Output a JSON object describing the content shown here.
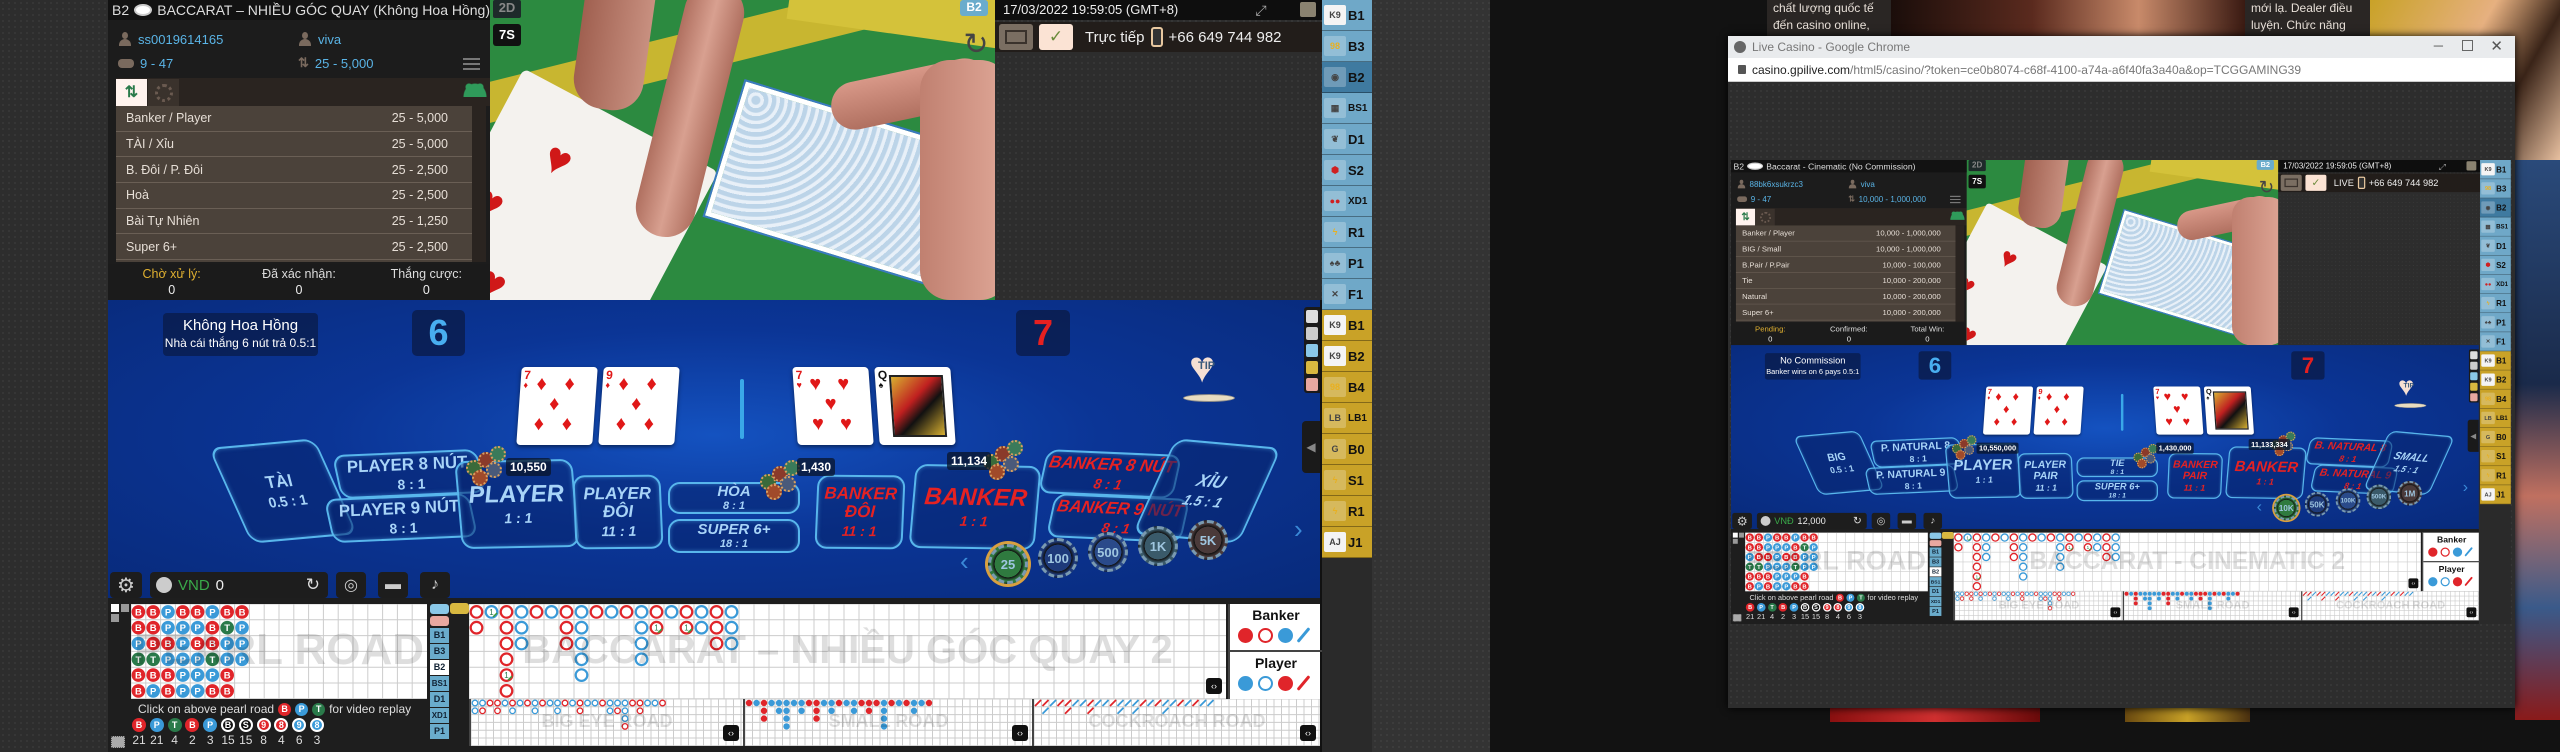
{
  "colors": {
    "table_blue": "#0b3596",
    "player_blue": "#3a9ad8",
    "banker_red": "#e0252a",
    "tie_green": "#2a7a4a",
    "sidebar_blue": "#6fa8c8",
    "sidebar_gold": "#c9a227",
    "accent_text": "#5ab4e6"
  },
  "main_game": {
    "title": {
      "table_code": "B2",
      "name": "BACCARAT – NHIỀU GÓC QUAY (Không Hoa Hồng)"
    },
    "user": {
      "account": "ss0019614165",
      "dealer": "viva",
      "round": "9 - 47",
      "limit": "25 - 5,000"
    },
    "limits": [
      {
        "label": "Banker / Player",
        "range": "25 - 5,000"
      },
      {
        "label": "TÀI / Xỉu",
        "range": "25 - 5,000"
      },
      {
        "label": "B. Đôi / P. Đôi",
        "range": "25 - 2,500"
      },
      {
        "label": "Hoà",
        "range": "25 - 2,500"
      },
      {
        "label": "Bài Tự Nhiên",
        "range": "25 - 1,250"
      },
      {
        "label": "Super 6+",
        "range": "25 - 2,500"
      }
    ],
    "status": [
      {
        "label": "Chờ xử lý:",
        "value": "0"
      },
      {
        "label": "Đã xác nhận:",
        "value": "0"
      },
      {
        "label": "Thắng cược:",
        "value": "0"
      }
    ],
    "video": {
      "mode": "2D",
      "shoe": "7S",
      "table": "B2"
    },
    "header": {
      "datetime": "17/03/2022 19:59:05 (GMT+8)",
      "live_label": "Trực tiếp",
      "phone": "+66 649 744 982"
    },
    "table": {
      "rule_title": "Không Hoa Hồng",
      "rule_desc": "Nhà cái thắng 6 nút trả 0.5:1",
      "player_score": "6",
      "banker_score": "7",
      "player_cards": [
        {
          "rank": "7",
          "suit": "♦"
        },
        {
          "rank": "9",
          "suit": "♦"
        }
      ],
      "banker_cards": [
        {
          "rank": "7",
          "suit": "♥"
        },
        {
          "rank": "Q",
          "suit": "♠"
        }
      ],
      "tip": "TIP",
      "bets": [
        {
          "key": "big",
          "label": "TÀI",
          "odds": "0.5 : 1"
        },
        {
          "key": "p8",
          "label": "PLAYER 8 NÚT",
          "odds": "8 : 1"
        },
        {
          "key": "p9",
          "label": "PLAYER 9 NÚT",
          "odds": "8 : 1"
        },
        {
          "key": "player",
          "label": "PLAYER",
          "odds": "1 : 1"
        },
        {
          "key": "ppair",
          "label": "PLAYER ĐÔI",
          "odds": "11 : 1"
        },
        {
          "key": "tie",
          "label": "HÒA",
          "odds": "8 : 1"
        },
        {
          "key": "super6",
          "label": "SUPER 6+",
          "odds": "18 : 1"
        },
        {
          "key": "bpair",
          "label": "BANKER ĐÔI",
          "odds": "11 : 1"
        },
        {
          "key": "banker",
          "label": "BANKER",
          "odds": "1 : 1"
        },
        {
          "key": "b8",
          "label": "BANKER 8 NÚT",
          "odds": "8 : 1"
        },
        {
          "key": "b9",
          "label": "BANKER 9 NÚT",
          "odds": "8 : 1"
        },
        {
          "key": "small",
          "label": "XỈU",
          "odds": "1.5 : 1"
        }
      ],
      "chip_totals": {
        "player": "10,550",
        "tie": "1,430",
        "banker": "11,134"
      },
      "chips": [
        "25",
        "100",
        "500",
        "1K",
        "5K"
      ],
      "selected_chip": "25",
      "currency": "VND",
      "balance": "0"
    },
    "roads": {
      "pearl_title": "PEARL ROAD",
      "big_road_title": "BACCARAT – NHIỀU GÓC QUAY 2",
      "big_eye_title": "BIG EYE ROAD",
      "small_title": "SMALL ROAD",
      "cockroach_title": "COCKROACH ROAD",
      "replay_hint_pre": "Click on above pearl road",
      "replay_hint_post": "for video replay",
      "legend": {
        "banker": "Banker",
        "player": "Player"
      }
    }
  },
  "popup_game": {
    "title": {
      "table_code": "B2",
      "name": "Baccarat - Cinematic (No Commission)"
    },
    "user": {
      "account": "88bk6xsukrzc3",
      "dealer": "viva",
      "round": "9 - 47",
      "limit": "10,000 - 1,000,000"
    },
    "limits": [
      {
        "label": "Banker / Player",
        "range": "10,000 - 1,000,000"
      },
      {
        "label": "BIG / Small",
        "range": "10,000 - 1,000,000"
      },
      {
        "label": "B.Pair / P.Pair",
        "range": "10,000 - 100,000"
      },
      {
        "label": "Tie",
        "range": "10,000 - 200,000"
      },
      {
        "label": "Natural",
        "range": "10,000 - 200,000"
      },
      {
        "label": "Super 6+",
        "range": "10,000 - 200,000"
      }
    ],
    "status": [
      {
        "label": "Pending:",
        "value": "0"
      },
      {
        "label": "Confirmed:",
        "value": "0"
      },
      {
        "label": "Total Win:",
        "value": "0"
      }
    ],
    "video": {
      "mode": "2D",
      "shoe": "7S",
      "table": "B2"
    },
    "header": {
      "datetime": "17/03/2022 19:59:05 (GMT+8)",
      "live_label": "LIVE",
      "phone": "+66 649 744 982"
    },
    "table": {
      "rule_title": "No Commission",
      "rule_desc": "Banker wins on 6 pays 0.5:1",
      "player_score": "6",
      "banker_score": "7",
      "player_cards": [
        {
          "rank": "7",
          "suit": "♦"
        },
        {
          "rank": "9",
          "suit": "♦"
        }
      ],
      "banker_cards": [
        {
          "rank": "7",
          "suit": "♥"
        },
        {
          "rank": "Q",
          "suit": "♠"
        }
      ],
      "tip": "TIP",
      "bets": [
        {
          "key": "big",
          "label": "BIG",
          "odds": "0.5 : 1"
        },
        {
          "key": "p8",
          "label": "P. NATURAL 8",
          "odds": "8 : 1"
        },
        {
          "key": "p9",
          "label": "P. NATURAL 9",
          "odds": "8 : 1"
        },
        {
          "key": "player",
          "label": "PLAYER",
          "odds": "1 : 1"
        },
        {
          "key": "ppair",
          "label": "PLAYER PAIR",
          "odds": "11 : 1"
        },
        {
          "key": "tie",
          "label": "TIE",
          "odds": "8 : 1"
        },
        {
          "key": "super6",
          "label": "SUPER 6+",
          "odds": "18 : 1"
        },
        {
          "key": "bpair",
          "label": "BANKER PAIR",
          "odds": "11 : 1"
        },
        {
          "key": "banker",
          "label": "BANKER",
          "odds": "1 : 1"
        },
        {
          "key": "b8",
          "label": "B. NATURAL 8",
          "odds": "8 : 1"
        },
        {
          "key": "b9",
          "label": "B. NATURAL 9",
          "odds": "8 : 1"
        },
        {
          "key": "small",
          "label": "SMALL",
          "odds": "1.5 : 1"
        }
      ],
      "chip_totals": {
        "player": "10,550,000",
        "tie": "1,430,000",
        "banker": "11,133,334"
      },
      "chips": [
        "10K",
        "50K",
        "100K",
        "500K",
        "1M"
      ],
      "selected_chip": "10K",
      "currency": "VNĐ",
      "balance": "12,000"
    },
    "roads": {
      "pearl_title": "PEARL ROAD",
      "big_road_title": "BACCARAT - CINEMATIC 2",
      "big_eye_title": "BIG EYE ROAD",
      "small_title": "SMALL ROAD",
      "cockroach_title": "COCKROACH ROAD",
      "replay_hint_pre": "Click on above pearl road",
      "replay_hint_post": "for video replay",
      "legend": {
        "banker": "Banker",
        "player": "Player"
      }
    }
  },
  "road_data": {
    "pearl_columns": [
      "BBPTBB",
      "BBBTBP",
      "PPBPBB",
      "BPPPPP",
      "BPBPPP",
      "PBBTPB",
      "BTPPBB",
      "BPPP"
    ],
    "big_road_columns": [
      "BB",
      "P",
      "BBBBBB",
      "PPP",
      "B",
      "P",
      "BBB",
      "PPPPP",
      "B",
      "P",
      "B",
      "PPPP",
      "BB",
      "P",
      "BB",
      "PP",
      "BBB",
      "PPP"
    ],
    "big_road_ties": [
      {
        "col": 1,
        "row": 0,
        "count": "1"
      },
      {
        "col": 2,
        "row": 4,
        "count": "1"
      },
      {
        "col": 12,
        "row": 1,
        "count": "1"
      },
      {
        "col": 14,
        "row": 1,
        "count": "1"
      }
    ],
    "big_eye_columns": [
      "bb",
      "br",
      "r",
      "rr",
      "b",
      "rb",
      "b",
      "r",
      "bb",
      "r",
      "b",
      "bb",
      "r",
      "b",
      "rr",
      "b",
      "b",
      "r",
      "bb",
      "br",
      "bbbr",
      "r",
      "rr",
      "b",
      "b",
      "r"
    ],
    "small_road_columns": [
      "r",
      "b",
      "rrr",
      "b",
      "bb",
      "bbbb",
      "b",
      "bb",
      "r",
      "rrr",
      "b",
      "bb",
      "r",
      "b",
      "bb",
      "r",
      "rr",
      "r",
      "bbbb",
      "r",
      "b",
      "r",
      "bb",
      "b",
      "r"
    ],
    "cockroach_columns": [
      "r",
      "rb",
      "b",
      "r",
      "rr",
      "b",
      "b",
      "rr",
      "b",
      "b",
      "r",
      "bb",
      "b",
      "bb",
      "r",
      "b",
      "r",
      "bb",
      "b",
      "r",
      "b",
      "r",
      "b",
      "b"
    ],
    "counts": [
      {
        "type": "banker",
        "glyph": "B",
        "n": "21"
      },
      {
        "type": "player",
        "glyph": "P",
        "n": "21"
      },
      {
        "type": "tie",
        "glyph": "T",
        "n": "4"
      },
      {
        "type": "banker-pair",
        "glyph": "B",
        "n": "2"
      },
      {
        "type": "player-pair",
        "glyph": "P",
        "n": "3"
      },
      {
        "type": "big",
        "glyph": "B",
        "n": "15"
      },
      {
        "type": "small",
        "glyph": "S",
        "n": "15"
      },
      {
        "type": "banker-natural-9",
        "glyph": "9",
        "n": "8"
      },
      {
        "type": "banker-natural-8",
        "glyph": "8",
        "n": "4"
      },
      {
        "type": "player-natural-9",
        "glyph": "9",
        "n": "6"
      },
      {
        "type": "player-natural-8",
        "glyph": "8",
        "n": "3"
      }
    ],
    "mini_tables": [
      "B1",
      "B3",
      "B2",
      "BS1",
      "D1",
      "XD1",
      "P1"
    ],
    "mini_tables_active": "B2"
  },
  "sidebar": {
    "active": "B2",
    "items": [
      {
        "label": "B1",
        "icon": "card-k9-icon",
        "group": "blue"
      },
      {
        "label": "B3",
        "icon": "lightning-98-icon",
        "group": "blue"
      },
      {
        "label": "B2",
        "icon": "baccarat-table-icon",
        "group": "blue"
      },
      {
        "label": "BS1",
        "icon": "dice-box-icon",
        "group": "blue"
      },
      {
        "label": "D1",
        "icon": "dragon-icon",
        "group": "blue"
      },
      {
        "label": "S2",
        "icon": "sicbo-dice-icon",
        "group": "blue"
      },
      {
        "label": "XD1",
        "icon": "xoc-dia-icon",
        "group": "blue"
      },
      {
        "label": "R1",
        "icon": "roulette-lightning-icon",
        "group": "blue"
      },
      {
        "label": "P1",
        "icon": "poker-cards-icon",
        "group": "blue"
      },
      {
        "label": "F1",
        "icon": "fan-tan-icon",
        "group": "blue"
      },
      {
        "label": "B1",
        "icon": "card-k9-icon",
        "group": "gold"
      },
      {
        "label": "B2",
        "icon": "card-k9-icon",
        "group": "gold"
      },
      {
        "label": "B4",
        "icon": "lightning-98-icon",
        "group": "gold"
      },
      {
        "label": "LB1",
        "icon": "lucky-baccarat-icon",
        "group": "gold"
      },
      {
        "label": "B0",
        "icon": "golden-icon",
        "group": "gold"
      },
      {
        "label": "S1",
        "icon": "sicbo-lightning-icon",
        "group": "gold"
      },
      {
        "label": "R1",
        "icon": "roulette-lightning-icon",
        "group": "gold"
      },
      {
        "label": "J1",
        "icon": "card-aj-icon",
        "group": "gold"
      }
    ]
  },
  "browser": {
    "window_title": "Live Casino - Google Chrome",
    "url_host": "casino.gpilive.com",
    "url_rest": "/html5/casino/?token=ce0b8074-c68f-4100-a74a-a6f40fa3a40a&op=TCGGAMING39"
  },
  "promo": {
    "left_text": [
      "chất lượng quốc tế",
      "đến casino online,"
    ],
    "right_text": [
      "mới lạ. Dealer điều",
      "luyện. Chức năng"
    ]
  }
}
